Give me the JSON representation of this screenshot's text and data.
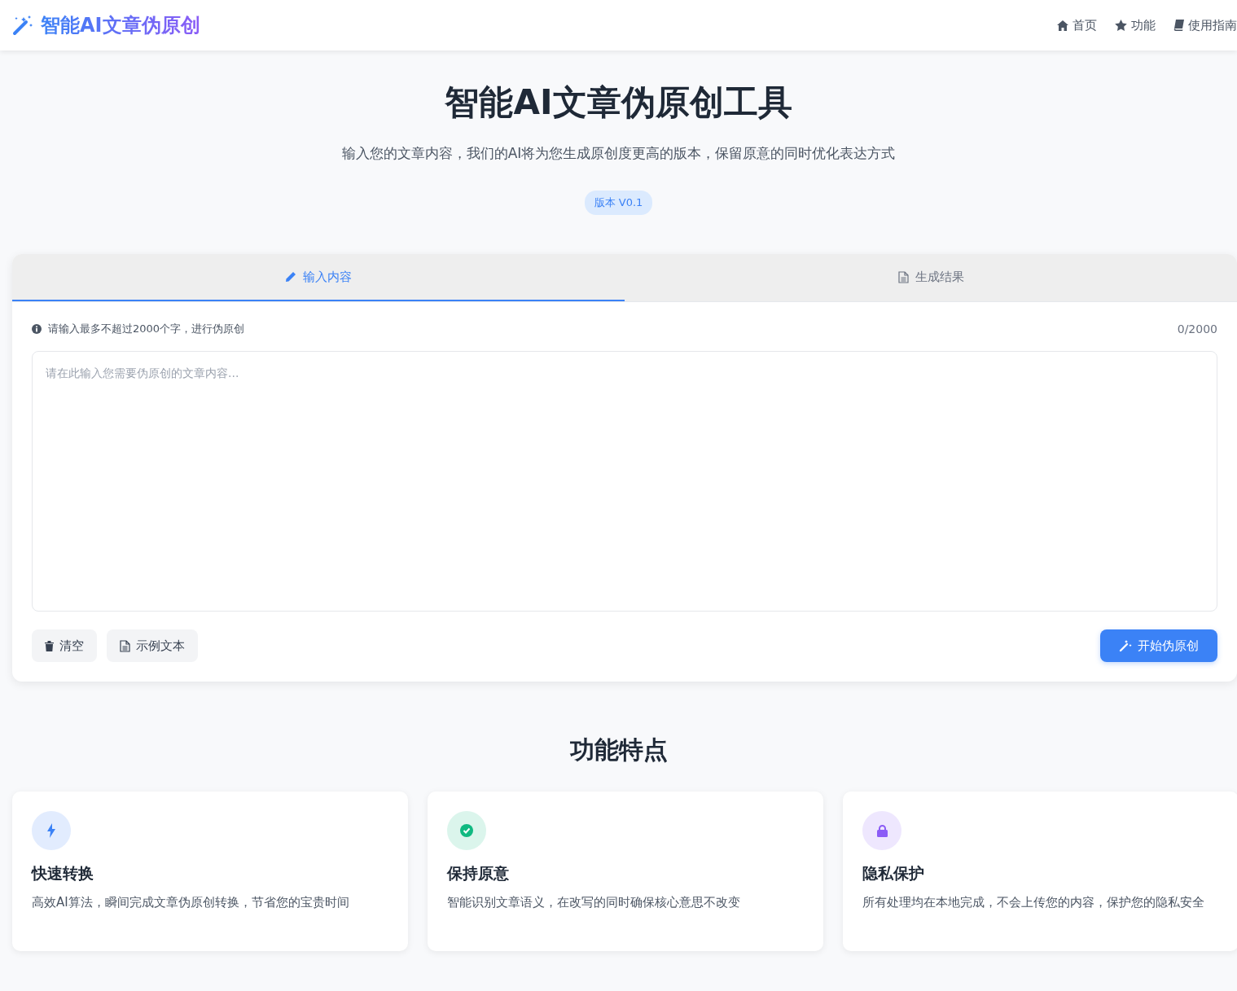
{
  "header": {
    "logo": "智能AI文章伪原创",
    "nav": [
      {
        "kind": "home",
        "label": "首页"
      },
      {
        "kind": "star",
        "label": "功能"
      },
      {
        "kind": "book",
        "label": "使用指南"
      }
    ]
  },
  "hero": {
    "title": "智能AI文章伪原创工具",
    "subtitle": "输入您的文章内容，我们的AI将为您生成原创度更高的版本，保留原意的同时优化表达方式",
    "badge": "版本 V0.1"
  },
  "tabs": [
    {
      "kind": "pencil",
      "label": "输入内容",
      "selected": true
    },
    {
      "kind": "file",
      "label": "生成结果",
      "selected": false
    }
  ],
  "editor": {
    "hint": "请输入最多不超过2000个字，进行伪原创",
    "counter": "0/2000",
    "placeholder": "请在此输入您需要伪原创的文章内容..."
  },
  "buttons": [
    {
      "kind": "trash",
      "label": "清空"
    },
    {
      "kind": "file",
      "label": "示例文本"
    }
  ],
  "primary_button": "开始伪原创",
  "features": {
    "title": "功能特点",
    "items": [
      {
        "kind": "bolt",
        "color": "#3b82f6",
        "title": "快速转换",
        "text": "高效AI算法，瞬间完成文章伪原创转换，节省您的宝贵时间"
      },
      {
        "kind": "check",
        "color": "#10b981",
        "title": "保持原意",
        "text": "智能识别文章语义，在改写的同时确保核心意思不改变"
      },
      {
        "kind": "lock",
        "color": "#8b5cf6",
        "title": "隐私保护",
        "text": "所有处理均在本地完成，不会上传您的内容，保护您的隐私安全"
      }
    ]
  }
}
